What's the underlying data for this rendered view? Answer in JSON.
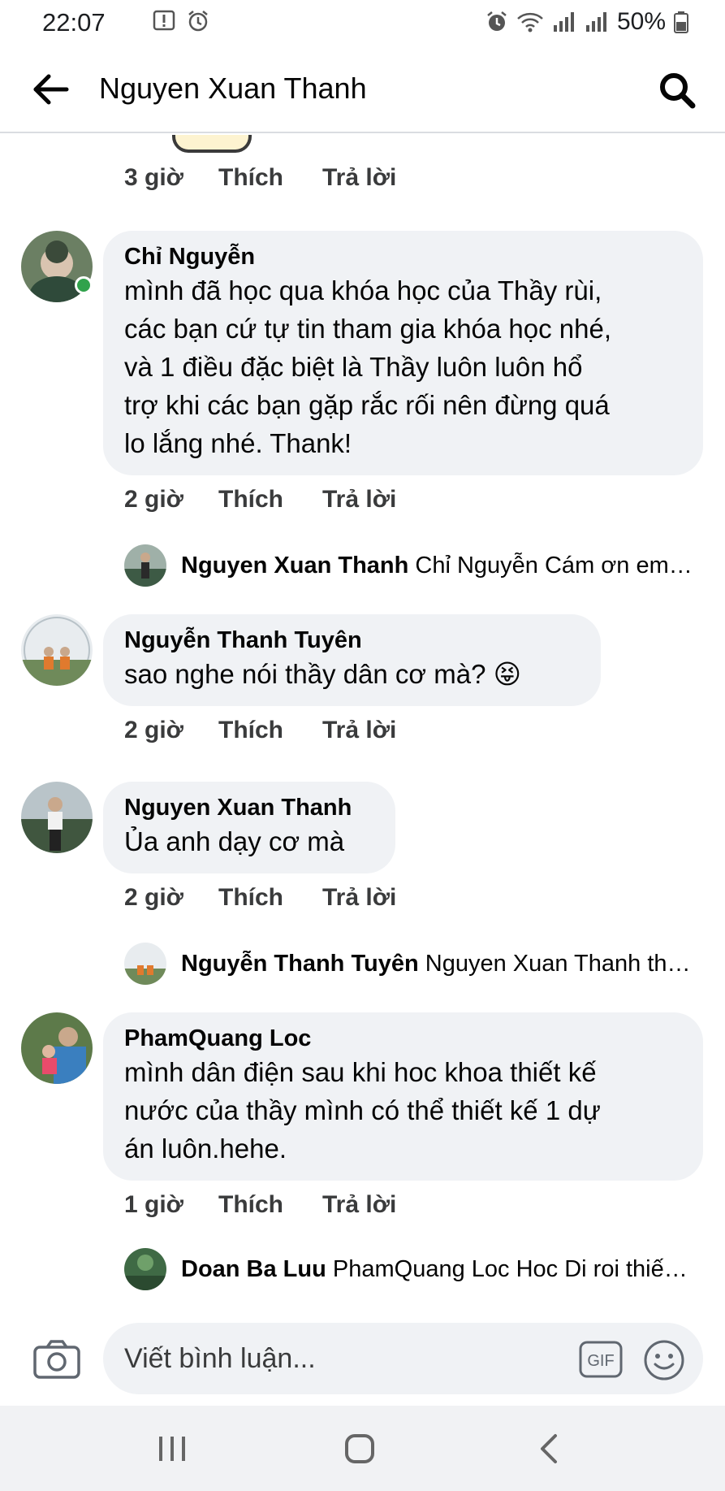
{
  "status_bar": {
    "time": "22:07",
    "battery": "50%",
    "icons": [
      "alert-icon",
      "alarm-icon",
      "wifi-icon",
      "signal-icon",
      "battery-icon"
    ]
  },
  "header": {
    "title": "Nguyen Xuan Thanh",
    "back_icon": "back-arrow-icon",
    "search_icon": "search-icon"
  },
  "actions": {
    "like": "Thích",
    "reply": "Trả lời"
  },
  "top_actions": {
    "time": "3 giờ"
  },
  "comments": [
    {
      "author": "Chỉ Nguyễn",
      "lines": [
        "mình đã học qua khóa học của Thầy rùi,",
        "các bạn cứ tự tin tham gia khóa học nhé,",
        "và 1 điều đặc biệt là Thầy luôn luôn hổ",
        "trợ khi các bạn gặp rắc  rối nên đừng quá",
        "lo lắng nhé. Thank!"
      ],
      "time": "2 giờ",
      "online": true,
      "reply_preview": {
        "author": "Nguyen Xuan Thanh",
        "text": "Chỉ Nguyễn Cám ơn em nhé"
      }
    },
    {
      "author": "Nguyễn Thanh Tuyên",
      "lines": [
        "sao nghe nói thầy dân cơ mà? 😝"
      ],
      "time": "2 giờ"
    },
    {
      "author": "Nguyen Xuan Thanh",
      "lines": [
        "Ủa anh dạy cơ mà"
      ],
      "time": "2 giờ",
      "reply_preview": {
        "author": "Nguyễn Thanh Tuyên",
        "text": "Nguyen Xuan Thanh thế à"
      }
    },
    {
      "author": "PhamQuang Loc",
      "lines": [
        "mình dân điện sau khi hoc khoa thiết kế",
        "nước của thầy mình có thể thiết kế  1 dự",
        "án luôn.hehe."
      ],
      "time": "1 giờ",
      "reply_preview": {
        "author": "Doan Ba Luu",
        "text": "PhamQuang Loc Hoc Di roi thiết kế"
      }
    }
  ],
  "composer": {
    "placeholder": "Viết bình luận...",
    "gif_label": "GIF"
  },
  "colors": {
    "bubble": "#f0f2f5",
    "online": "#31a24c",
    "text": "#050505"
  }
}
